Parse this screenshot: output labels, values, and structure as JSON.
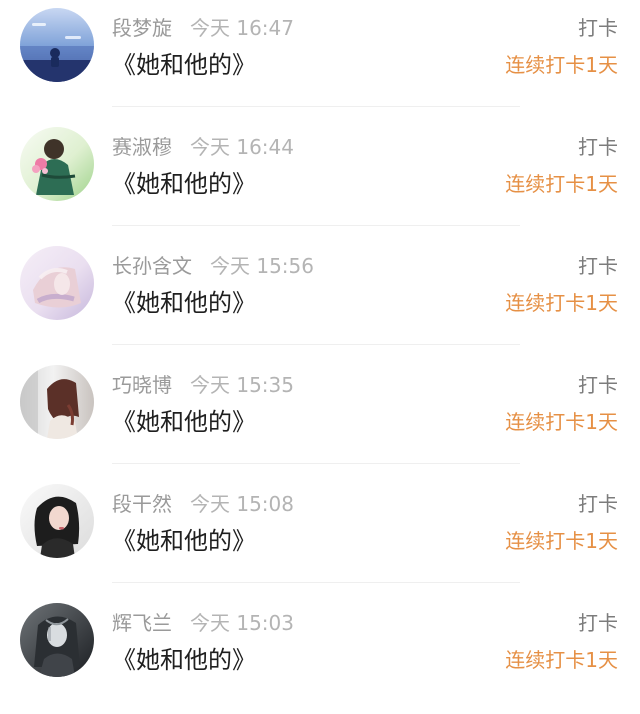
{
  "feed": {
    "items": [
      {
        "name": "段梦旋",
        "time": "今天 16:47",
        "title": "《她和他的》",
        "action": "打卡",
        "streak": "连续打卡1天",
        "avatar_icon": "sky-landscape-avatar-icon"
      },
      {
        "name": "赛淑穆",
        "time": "今天 16:44",
        "title": "《她和他的》",
        "action": "打卡",
        "streak": "连续打卡1天",
        "avatar_icon": "anime-girl-avatar-icon"
      },
      {
        "name": "长孙含文",
        "time": "今天 15:56",
        "title": "《她和他的》",
        "action": "打卡",
        "streak": "连续打卡1天",
        "avatar_icon": "pastel-illustration-avatar-icon"
      },
      {
        "name": "巧晓博",
        "time": "今天 15:35",
        "title": "《她和他的》",
        "action": "打卡",
        "streak": "连续打卡1天",
        "avatar_icon": "portrait-photo-avatar-icon"
      },
      {
        "name": "段干然",
        "time": "今天 15:08",
        "title": "《她和他的》",
        "action": "打卡",
        "streak": "连续打卡1天",
        "avatar_icon": "dark-hair-portrait-avatar-icon"
      },
      {
        "name": "辉飞兰",
        "time": "今天 15:03",
        "title": "《她和他的》",
        "action": "打卡",
        "streak": "连续打卡1天",
        "avatar_icon": "monochrome-anime-avatar-icon"
      }
    ]
  },
  "colors": {
    "streak_accent": "#e69045",
    "name_text": "#9a9a9a",
    "title_text": "#1f1f1f",
    "divider": "#efefef"
  }
}
